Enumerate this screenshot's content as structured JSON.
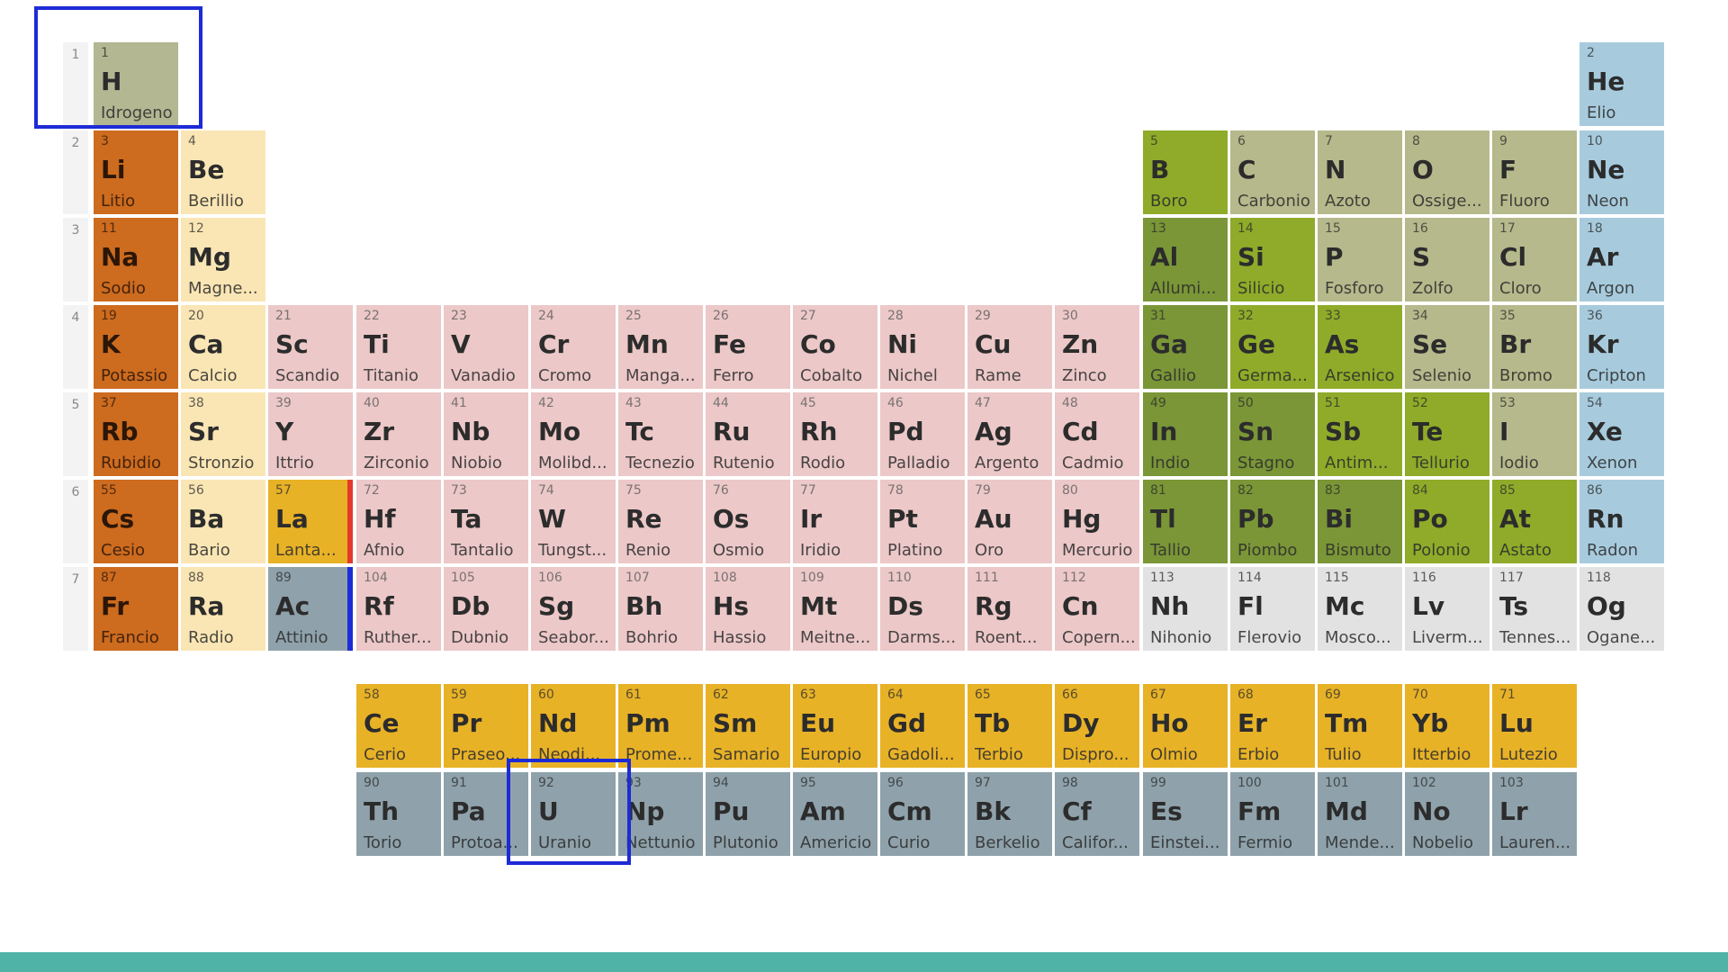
{
  "colors": {
    "alkali": "#cd6b1f",
    "alkaline": "#fae6b4",
    "transition": "#ecc8c8",
    "lanthanide": "#e8b227",
    "actinide": "#8fa2ab",
    "post_transition": "#7a9637",
    "metalloid": "#8fab29",
    "nonmetal": "#b6b98b",
    "noble": "#a7cbdd",
    "hydrogen": "#b3b792",
    "unknown": "#e2e2e2",
    "period_bg": "#f3f3f3",
    "highlight": "#1d2bd6",
    "footer": "#4fb4a7",
    "lanthanum_marker": "#e53a2b",
    "actinium_marker": "#1d2bd6"
  },
  "period_labels": [
    "1",
    "2",
    "3",
    "4",
    "5",
    "6",
    "7"
  ],
  "elements": [
    {
      "n": "1",
      "s": "H",
      "name": "Idrogeno",
      "cat": "hydrogen",
      "r": 1,
      "c": 1
    },
    {
      "n": "2",
      "s": "He",
      "name": "Elio",
      "cat": "noble",
      "r": 1,
      "c": 18
    },
    {
      "n": "3",
      "s": "Li",
      "name": "Litio",
      "cat": "alkali",
      "r": 2,
      "c": 1
    },
    {
      "n": "4",
      "s": "Be",
      "name": "Berillio",
      "cat": "alkaline",
      "r": 2,
      "c": 2
    },
    {
      "n": "5",
      "s": "B",
      "name": "Boro",
      "cat": "metalloid",
      "r": 2,
      "c": 13
    },
    {
      "n": "6",
      "s": "C",
      "name": "Carbonio",
      "cat": "nonmetal",
      "r": 2,
      "c": 14
    },
    {
      "n": "7",
      "s": "N",
      "name": "Azoto",
      "cat": "nonmetal",
      "r": 2,
      "c": 15
    },
    {
      "n": "8",
      "s": "O",
      "name": "Ossige...",
      "cat": "nonmetal",
      "r": 2,
      "c": 16
    },
    {
      "n": "9",
      "s": "F",
      "name": "Fluoro",
      "cat": "nonmetal",
      "r": 2,
      "c": 17
    },
    {
      "n": "10",
      "s": "Ne",
      "name": "Neon",
      "cat": "noble",
      "r": 2,
      "c": 18
    },
    {
      "n": "11",
      "s": "Na",
      "name": "Sodio",
      "cat": "alkali",
      "r": 3,
      "c": 1
    },
    {
      "n": "12",
      "s": "Mg",
      "name": "Magne...",
      "cat": "alkaline",
      "r": 3,
      "c": 2
    },
    {
      "n": "13",
      "s": "Al",
      "name": "Allumi...",
      "cat": "post_transition",
      "r": 3,
      "c": 13
    },
    {
      "n": "14",
      "s": "Si",
      "name": "Silicio",
      "cat": "metalloid",
      "r": 3,
      "c": 14
    },
    {
      "n": "15",
      "s": "P",
      "name": "Fosforo",
      "cat": "nonmetal",
      "r": 3,
      "c": 15
    },
    {
      "n": "16",
      "s": "S",
      "name": "Zolfo",
      "cat": "nonmetal",
      "r": 3,
      "c": 16
    },
    {
      "n": "17",
      "s": "Cl",
      "name": "Cloro",
      "cat": "nonmetal",
      "r": 3,
      "c": 17
    },
    {
      "n": "18",
      "s": "Ar",
      "name": "Argon",
      "cat": "noble",
      "r": 3,
      "c": 18
    },
    {
      "n": "19",
      "s": "K",
      "name": "Potassio",
      "cat": "alkali",
      "r": 4,
      "c": 1
    },
    {
      "n": "20",
      "s": "Ca",
      "name": "Calcio",
      "cat": "alkaline",
      "r": 4,
      "c": 2
    },
    {
      "n": "21",
      "s": "Sc",
      "name": "Scandio",
      "cat": "transition",
      "r": 4,
      "c": 3
    },
    {
      "n": "22",
      "s": "Ti",
      "name": "Titanio",
      "cat": "transition",
      "r": 4,
      "c": 4
    },
    {
      "n": "23",
      "s": "V",
      "name": "Vanadio",
      "cat": "transition",
      "r": 4,
      "c": 5
    },
    {
      "n": "24",
      "s": "Cr",
      "name": "Cromo",
      "cat": "transition",
      "r": 4,
      "c": 6
    },
    {
      "n": "25",
      "s": "Mn",
      "name": "Manga...",
      "cat": "transition",
      "r": 4,
      "c": 7
    },
    {
      "n": "26",
      "s": "Fe",
      "name": "Ferro",
      "cat": "transition",
      "r": 4,
      "c": 8
    },
    {
      "n": "27",
      "s": "Co",
      "name": "Cobalto",
      "cat": "transition",
      "r": 4,
      "c": 9
    },
    {
      "n": "28",
      "s": "Ni",
      "name": "Nichel",
      "cat": "transition",
      "r": 4,
      "c": 10
    },
    {
      "n": "29",
      "s": "Cu",
      "name": "Rame",
      "cat": "transition",
      "r": 4,
      "c": 11
    },
    {
      "n": "30",
      "s": "Zn",
      "name": "Zinco",
      "cat": "transition",
      "r": 4,
      "c": 12
    },
    {
      "n": "31",
      "s": "Ga",
      "name": "Gallio",
      "cat": "post_transition",
      "r": 4,
      "c": 13
    },
    {
      "n": "32",
      "s": "Ge",
      "name": "Germa...",
      "cat": "metalloid",
      "r": 4,
      "c": 14
    },
    {
      "n": "33",
      "s": "As",
      "name": "Arsenico",
      "cat": "metalloid",
      "r": 4,
      "c": 15
    },
    {
      "n": "34",
      "s": "Se",
      "name": "Selenio",
      "cat": "nonmetal",
      "r": 4,
      "c": 16
    },
    {
      "n": "35",
      "s": "Br",
      "name": "Bromo",
      "cat": "nonmetal",
      "r": 4,
      "c": 17
    },
    {
      "n": "36",
      "s": "Kr",
      "name": "Cripton",
      "cat": "noble",
      "r": 4,
      "c": 18
    },
    {
      "n": "37",
      "s": "Rb",
      "name": "Rubidio",
      "cat": "alkali",
      "r": 5,
      "c": 1
    },
    {
      "n": "38",
      "s": "Sr",
      "name": "Stronzio",
      "cat": "alkaline",
      "r": 5,
      "c": 2
    },
    {
      "n": "39",
      "s": "Y",
      "name": "Ittrio",
      "cat": "transition",
      "r": 5,
      "c": 3
    },
    {
      "n": "40",
      "s": "Zr",
      "name": "Zirconio",
      "cat": "transition",
      "r": 5,
      "c": 4
    },
    {
      "n": "41",
      "s": "Nb",
      "name": "Niobio",
      "cat": "transition",
      "r": 5,
      "c": 5
    },
    {
      "n": "42",
      "s": "Mo",
      "name": "Molibd...",
      "cat": "transition",
      "r": 5,
      "c": 6
    },
    {
      "n": "43",
      "s": "Tc",
      "name": "Tecnezio",
      "cat": "transition",
      "r": 5,
      "c": 7
    },
    {
      "n": "44",
      "s": "Ru",
      "name": "Rutenio",
      "cat": "transition",
      "r": 5,
      "c": 8
    },
    {
      "n": "45",
      "s": "Rh",
      "name": "Rodio",
      "cat": "transition",
      "r": 5,
      "c": 9
    },
    {
      "n": "46",
      "s": "Pd",
      "name": "Palladio",
      "cat": "transition",
      "r": 5,
      "c": 10
    },
    {
      "n": "47",
      "s": "Ag",
      "name": "Argento",
      "cat": "transition",
      "r": 5,
      "c": 11
    },
    {
      "n": "48",
      "s": "Cd",
      "name": "Cadmio",
      "cat": "transition",
      "r": 5,
      "c": 12
    },
    {
      "n": "49",
      "s": "In",
      "name": "Indio",
      "cat": "post_transition",
      "r": 5,
      "c": 13
    },
    {
      "n": "50",
      "s": "Sn",
      "name": "Stagno",
      "cat": "post_transition",
      "r": 5,
      "c": 14
    },
    {
      "n": "51",
      "s": "Sb",
      "name": "Antim...",
      "cat": "metalloid",
      "r": 5,
      "c": 15
    },
    {
      "n": "52",
      "s": "Te",
      "name": "Tellurio",
      "cat": "metalloid",
      "r": 5,
      "c": 16
    },
    {
      "n": "53",
      "s": "I",
      "name": "Iodio",
      "cat": "nonmetal",
      "r": 5,
      "c": 17
    },
    {
      "n": "54",
      "s": "Xe",
      "name": "Xenon",
      "cat": "noble",
      "r": 5,
      "c": 18
    },
    {
      "n": "55",
      "s": "Cs",
      "name": "Cesio",
      "cat": "alkali",
      "r": 6,
      "c": 1
    },
    {
      "n": "56",
      "s": "Ba",
      "name": "Bario",
      "cat": "alkaline",
      "r": 6,
      "c": 2
    },
    {
      "n": "57",
      "s": "La",
      "name": "Lanta...",
      "cat": "lanthanide",
      "r": 6,
      "c": 3
    },
    {
      "n": "72",
      "s": "Hf",
      "name": "Afnio",
      "cat": "transition",
      "r": 6,
      "c": 4
    },
    {
      "n": "73",
      "s": "Ta",
      "name": "Tantalio",
      "cat": "transition",
      "r": 6,
      "c": 5
    },
    {
      "n": "74",
      "s": "W",
      "name": "Tungst...",
      "cat": "transition",
      "r": 6,
      "c": 6
    },
    {
      "n": "75",
      "s": "Re",
      "name": "Renio",
      "cat": "transition",
      "r": 6,
      "c": 7
    },
    {
      "n": "76",
      "s": "Os",
      "name": "Osmio",
      "cat": "transition",
      "r": 6,
      "c": 8
    },
    {
      "n": "77",
      "s": "Ir",
      "name": "Iridio",
      "cat": "transition",
      "r": 6,
      "c": 9
    },
    {
      "n": "78",
      "s": "Pt",
      "name": "Platino",
      "cat": "transition",
      "r": 6,
      "c": 10
    },
    {
      "n": "79",
      "s": "Au",
      "name": "Oro",
      "cat": "transition",
      "r": 6,
      "c": 11
    },
    {
      "n": "80",
      "s": "Hg",
      "name": "Mercurio",
      "cat": "transition",
      "r": 6,
      "c": 12
    },
    {
      "n": "81",
      "s": "Tl",
      "name": "Tallio",
      "cat": "post_transition",
      "r": 6,
      "c": 13
    },
    {
      "n": "82",
      "s": "Pb",
      "name": "Piombo",
      "cat": "post_transition",
      "r": 6,
      "c": 14
    },
    {
      "n": "83",
      "s": "Bi",
      "name": "Bismuto",
      "cat": "post_transition",
      "r": 6,
      "c": 15
    },
    {
      "n": "84",
      "s": "Po",
      "name": "Polonio",
      "cat": "metalloid",
      "r": 6,
      "c": 16
    },
    {
      "n": "85",
      "s": "At",
      "name": "Astato",
      "cat": "metalloid",
      "r": 6,
      "c": 17
    },
    {
      "n": "86",
      "s": "Rn",
      "name": "Radon",
      "cat": "noble",
      "r": 6,
      "c": 18
    },
    {
      "n": "87",
      "s": "Fr",
      "name": "Francio",
      "cat": "alkali",
      "r": 7,
      "c": 1
    },
    {
      "n": "88",
      "s": "Ra",
      "name": "Radio",
      "cat": "alkaline",
      "r": 7,
      "c": 2
    },
    {
      "n": "89",
      "s": "Ac",
      "name": "Attinio",
      "cat": "actinide",
      "r": 7,
      "c": 3
    },
    {
      "n": "104",
      "s": "Rf",
      "name": "Ruther...",
      "cat": "transition",
      "r": 7,
      "c": 4
    },
    {
      "n": "105",
      "s": "Db",
      "name": "Dubnio",
      "cat": "transition",
      "r": 7,
      "c": 5
    },
    {
      "n": "106",
      "s": "Sg",
      "name": "Seabor...",
      "cat": "transition",
      "r": 7,
      "c": 6
    },
    {
      "n": "107",
      "s": "Bh",
      "name": "Bohrio",
      "cat": "transition",
      "r": 7,
      "c": 7
    },
    {
      "n": "108",
      "s": "Hs",
      "name": "Hassio",
      "cat": "transition",
      "r": 7,
      "c": 8
    },
    {
      "n": "109",
      "s": "Mt",
      "name": "Meitne...",
      "cat": "transition",
      "r": 7,
      "c": 9
    },
    {
      "n": "110",
      "s": "Ds",
      "name": "Darms...",
      "cat": "transition",
      "r": 7,
      "c": 10
    },
    {
      "n": "111",
      "s": "Rg",
      "name": "Roent...",
      "cat": "transition",
      "r": 7,
      "c": 11
    },
    {
      "n": "112",
      "s": "Cn",
      "name": "Copern...",
      "cat": "transition",
      "r": 7,
      "c": 12
    },
    {
      "n": "113",
      "s": "Nh",
      "name": "Nihonio",
      "cat": "unknown",
      "r": 7,
      "c": 13
    },
    {
      "n": "114",
      "s": "Fl",
      "name": "Flerovio",
      "cat": "unknown",
      "r": 7,
      "c": 14
    },
    {
      "n": "115",
      "s": "Mc",
      "name": "Mosco...",
      "cat": "unknown",
      "r": 7,
      "c": 15
    },
    {
      "n": "116",
      "s": "Lv",
      "name": "Liverm...",
      "cat": "unknown",
      "r": 7,
      "c": 16
    },
    {
      "n": "117",
      "s": "Ts",
      "name": "Tennes...",
      "cat": "unknown",
      "r": 7,
      "c": 17
    },
    {
      "n": "118",
      "s": "Og",
      "name": "Ogane...",
      "cat": "unknown",
      "r": 7,
      "c": 18
    },
    {
      "n": "58",
      "s": "Ce",
      "name": "Cerio",
      "cat": "lanthanide",
      "r": 9,
      "c": 4
    },
    {
      "n": "59",
      "s": "Pr",
      "name": "Praseo...",
      "cat": "lanthanide",
      "r": 9,
      "c": 5
    },
    {
      "n": "60",
      "s": "Nd",
      "name": "Neodi...",
      "cat": "lanthanide",
      "r": 9,
      "c": 6
    },
    {
      "n": "61",
      "s": "Pm",
      "name": "Prome...",
      "cat": "lanthanide",
      "r": 9,
      "c": 7
    },
    {
      "n": "62",
      "s": "Sm",
      "name": "Samario",
      "cat": "lanthanide",
      "r": 9,
      "c": 8
    },
    {
      "n": "63",
      "s": "Eu",
      "name": "Europio",
      "cat": "lanthanide",
      "r": 9,
      "c": 9
    },
    {
      "n": "64",
      "s": "Gd",
      "name": "Gadoli...",
      "cat": "lanthanide",
      "r": 9,
      "c": 10
    },
    {
      "n": "65",
      "s": "Tb",
      "name": "Terbio",
      "cat": "lanthanide",
      "r": 9,
      "c": 11
    },
    {
      "n": "66",
      "s": "Dy",
      "name": "Dispro...",
      "cat": "lanthanide",
      "r": 9,
      "c": 12
    },
    {
      "n": "67",
      "s": "Ho",
      "name": "Olmio",
      "cat": "lanthanide",
      "r": 9,
      "c": 13
    },
    {
      "n": "68",
      "s": "Er",
      "name": "Erbio",
      "cat": "lanthanide",
      "r": 9,
      "c": 14
    },
    {
      "n": "69",
      "s": "Tm",
      "name": "Tulio",
      "cat": "lanthanide",
      "r": 9,
      "c": 15
    },
    {
      "n": "70",
      "s": "Yb",
      "name": "Itterbio",
      "cat": "lanthanide",
      "r": 9,
      "c": 16
    },
    {
      "n": "71",
      "s": "Lu",
      "name": "Lutezio",
      "cat": "lanthanide",
      "r": 9,
      "c": 17
    },
    {
      "n": "90",
      "s": "Th",
      "name": "Torio",
      "cat": "actinide",
      "r": 10,
      "c": 4
    },
    {
      "n": "91",
      "s": "Pa",
      "name": "Protoa...",
      "cat": "actinide",
      "r": 10,
      "c": 5
    },
    {
      "n": "92",
      "s": "U",
      "name": "Uranio",
      "cat": "actinide",
      "r": 10,
      "c": 6
    },
    {
      "n": "93",
      "s": "Np",
      "name": "Nettunio",
      "cat": "actinide",
      "r": 10,
      "c": 7
    },
    {
      "n": "94",
      "s": "Pu",
      "name": "Plutonio",
      "cat": "actinide",
      "r": 10,
      "c": 8
    },
    {
      "n": "95",
      "s": "Am",
      "name": "Americio",
      "cat": "actinide",
      "r": 10,
      "c": 9
    },
    {
      "n": "96",
      "s": "Cm",
      "name": "Curio",
      "cat": "actinide",
      "r": 10,
      "c": 10
    },
    {
      "n": "97",
      "s": "Bk",
      "name": "Berkelio",
      "cat": "actinide",
      "r": 10,
      "c": 11
    },
    {
      "n": "98",
      "s": "Cf",
      "name": "Califor...",
      "cat": "actinide",
      "r": 10,
      "c": 12
    },
    {
      "n": "99",
      "s": "Es",
      "name": "Einstei...",
      "cat": "actinide",
      "r": 10,
      "c": 13
    },
    {
      "n": "100",
      "s": "Fm",
      "name": "Fermio",
      "cat": "actinide",
      "r": 10,
      "c": 14
    },
    {
      "n": "101",
      "s": "Md",
      "name": "Mende...",
      "cat": "actinide",
      "r": 10,
      "c": 15
    },
    {
      "n": "102",
      "s": "No",
      "name": "Nobelio",
      "cat": "actinide",
      "r": 10,
      "c": 16
    },
    {
      "n": "103",
      "s": "Lr",
      "name": "Lauren...",
      "cat": "actinide",
      "r": 10,
      "c": 17
    }
  ],
  "highlighted_elements": [
    "H",
    "U"
  ]
}
